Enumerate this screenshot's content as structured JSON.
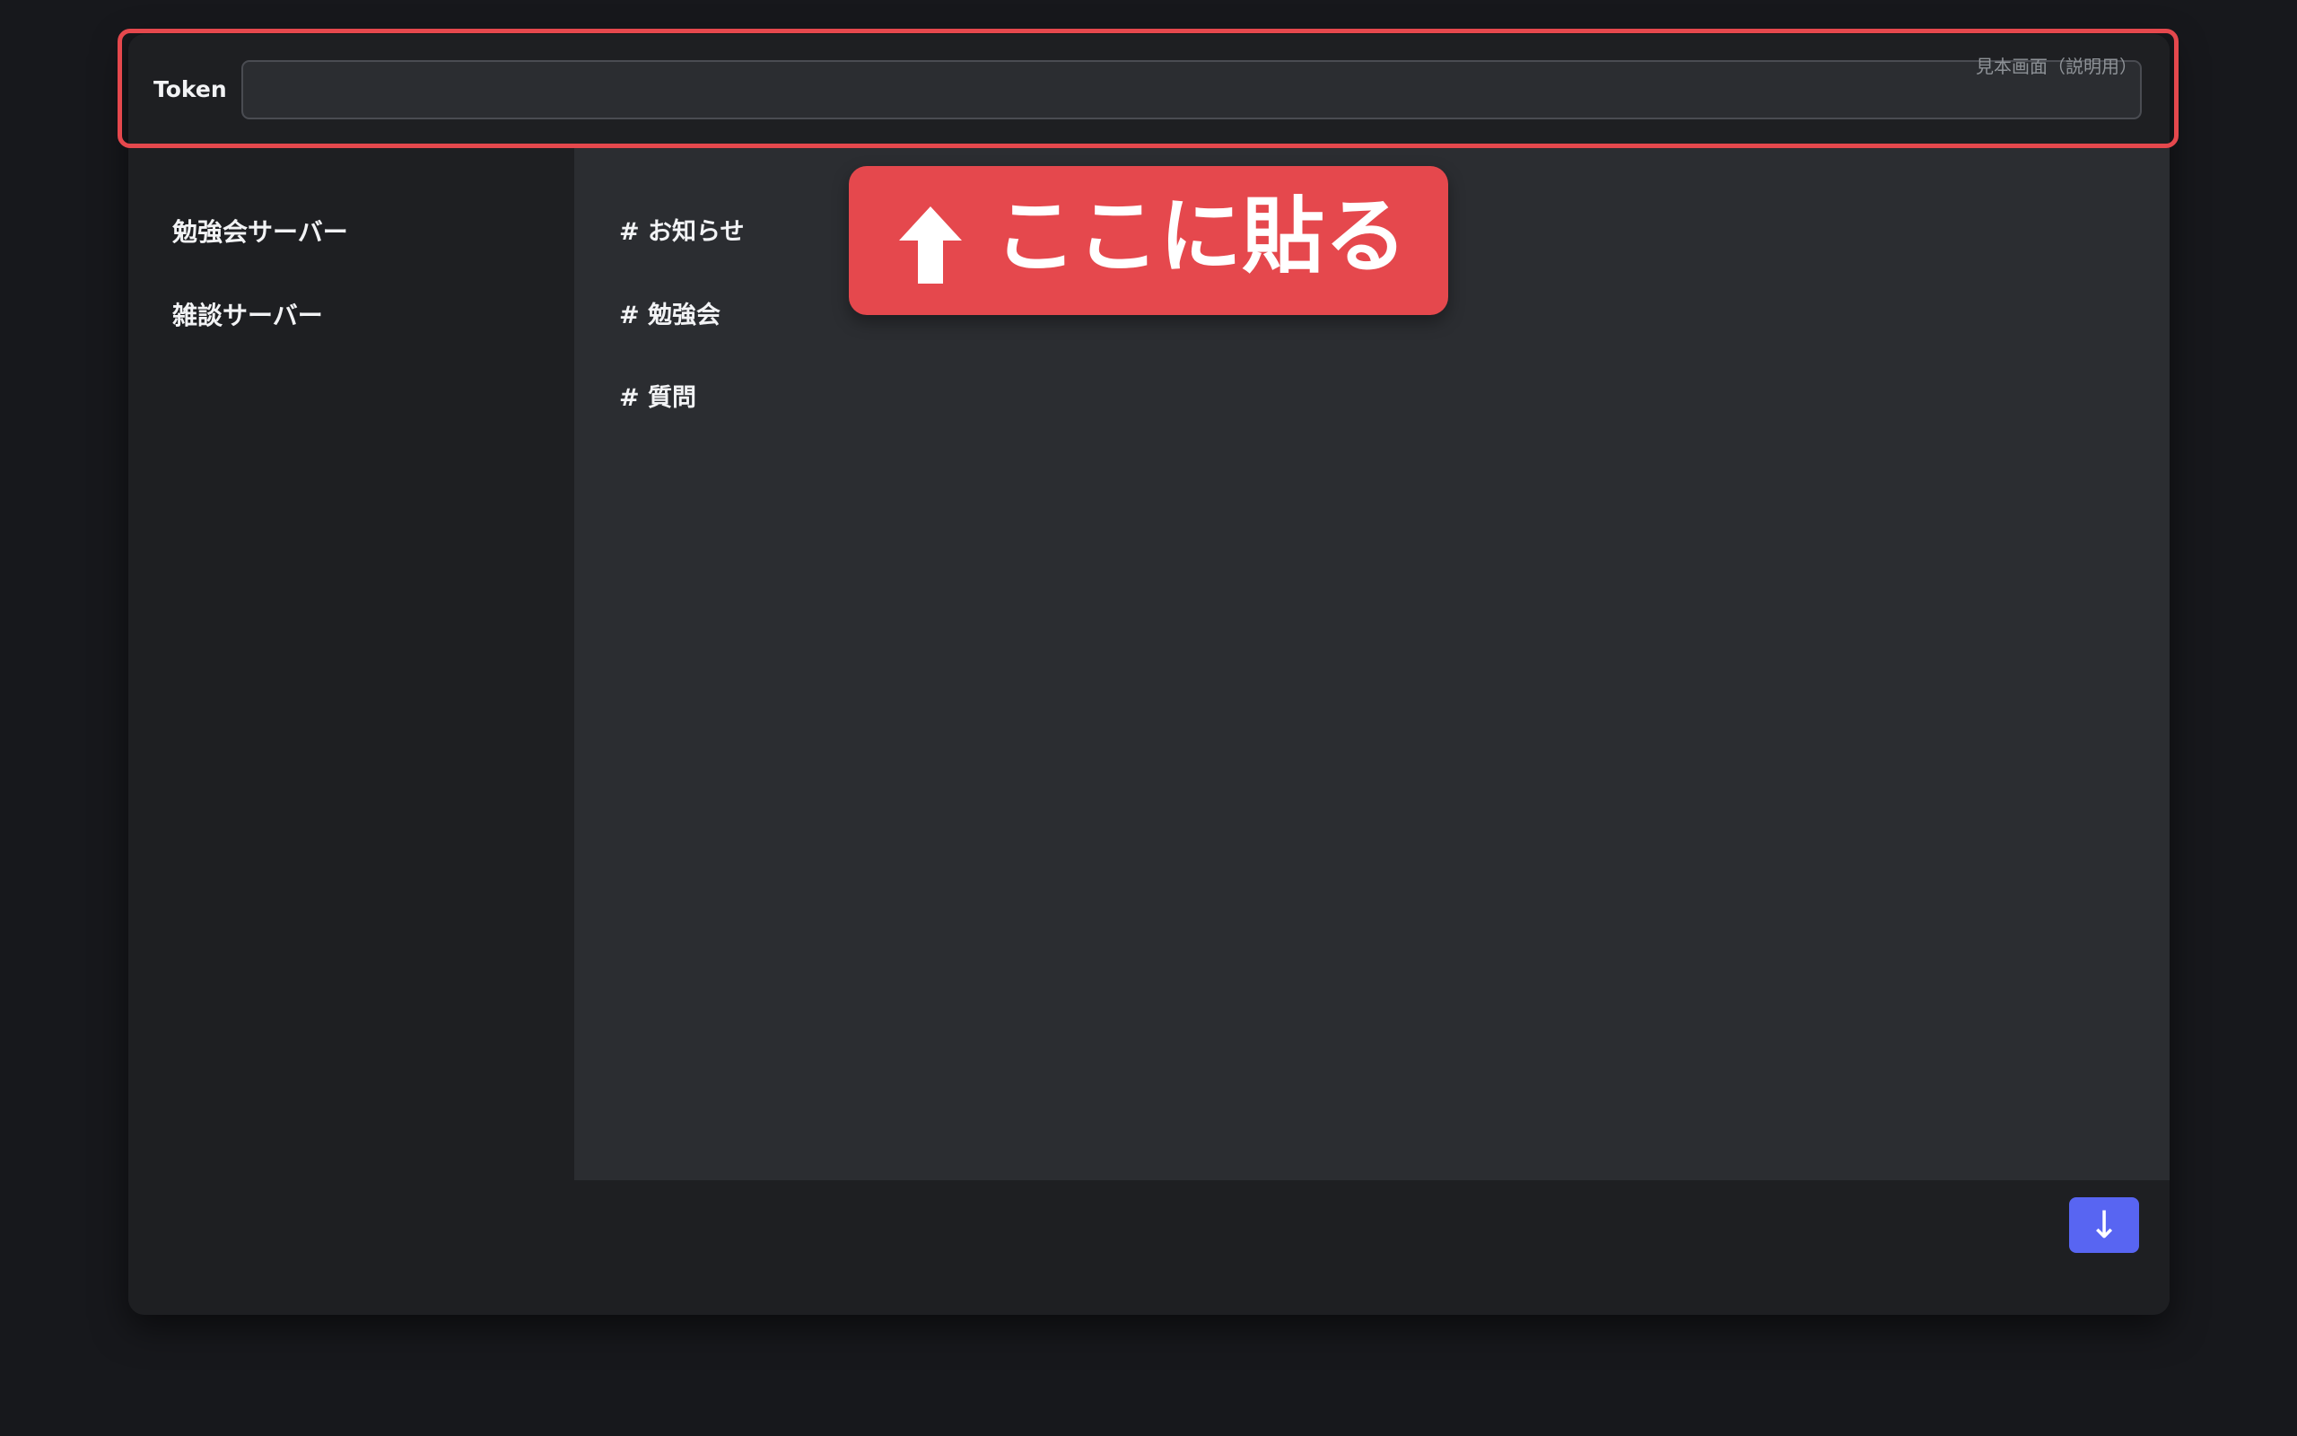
{
  "token_bar": {
    "label": "Token",
    "input_value": "",
    "input_placeholder": "",
    "sample_note": "見本画面（説明用）"
  },
  "servers": [
    {
      "label": "勉強会サーバー"
    },
    {
      "label": "雑談サーバー"
    }
  ],
  "channels": [
    {
      "label": "# お知らせ"
    },
    {
      "label": "# 勉強会"
    },
    {
      "label": "# 質問"
    }
  ],
  "callout": {
    "text": "ここに貼る",
    "icon": "up-arrow-icon"
  },
  "footer": {
    "scroll_button_label": "↓"
  },
  "colors": {
    "page_background": "#17181c",
    "panel_dark": "#1e1f22",
    "panel_channels": "#2b2d31",
    "highlight": "#e5484d",
    "accent_button": "#5865f2"
  }
}
